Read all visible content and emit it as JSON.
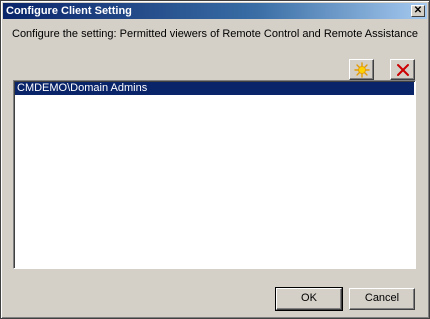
{
  "window": {
    "title": "Configure Client Setting",
    "close_glyph": "✕"
  },
  "prompt": "Configure the setting: Permitted viewers of Remote Control and Remote Assistance",
  "toolbar": {
    "new_icon": "starburst-icon",
    "delete_icon": "red-x-icon"
  },
  "list": {
    "items": [
      {
        "label": "CMDEMO\\Domain Admins",
        "selected": true
      }
    ]
  },
  "buttons": {
    "ok_label": "OK",
    "cancel_label": "Cancel"
  },
  "colors": {
    "titlebar": "#0a246a",
    "selection": "#0a246a",
    "face": "#d4d0c8",
    "delete_red": "#cc0000",
    "star_yellow": "#ffd200"
  }
}
